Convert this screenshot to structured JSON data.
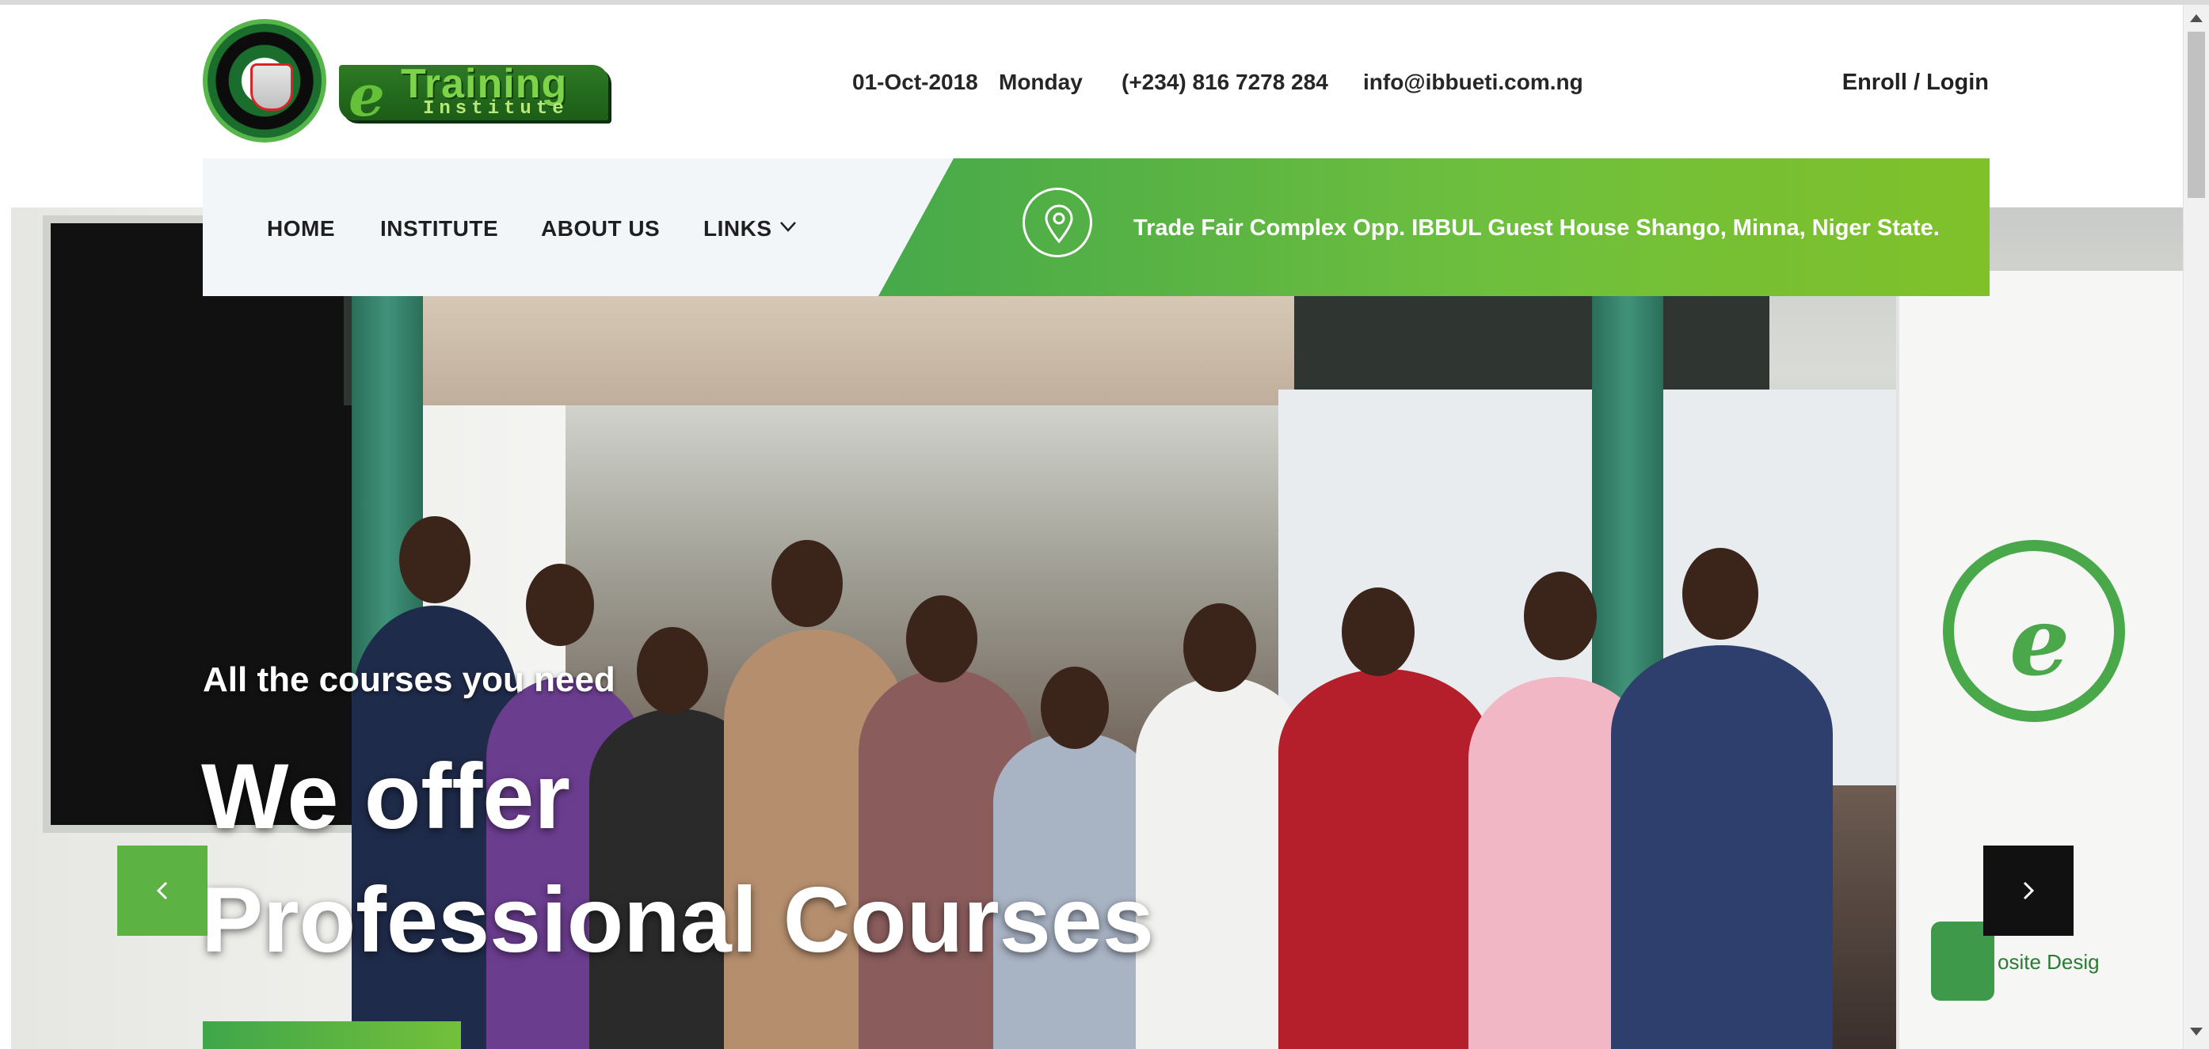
{
  "header": {
    "logo_alt": "IBB University eTraining Institute",
    "logo_word": "Training",
    "logo_sub": "Institute",
    "date": "01-Oct-2018",
    "day": "Monday",
    "phone": "(+234) 816 7278 284",
    "email": "info@ibbueti.com.ng",
    "enroll_login": "Enroll / Login"
  },
  "nav": {
    "items": [
      {
        "label": "HOME"
      },
      {
        "label": "INSTITUTE"
      },
      {
        "label": "ABOUT US"
      },
      {
        "label": "LINKS"
      }
    ],
    "address": "Trade Fair Complex Opp. IBBUL Guest House Shango, Minna, Niger State."
  },
  "hero": {
    "subtitle": "All the courses you need",
    "title_line1": "We offer",
    "title_line2": "Professional Courses",
    "banner_text": "osite Desig"
  },
  "colors": {
    "brand_green": "#5cb344",
    "gradient_end": "#80c12a",
    "nav_bg": "#f3f6f8",
    "arrow_dark": "#111111"
  },
  "icons": {
    "location": "map-pin-icon",
    "links_dropdown": "chevron-down-icon",
    "prev": "chevron-left-icon",
    "next": "chevron-right-icon"
  }
}
